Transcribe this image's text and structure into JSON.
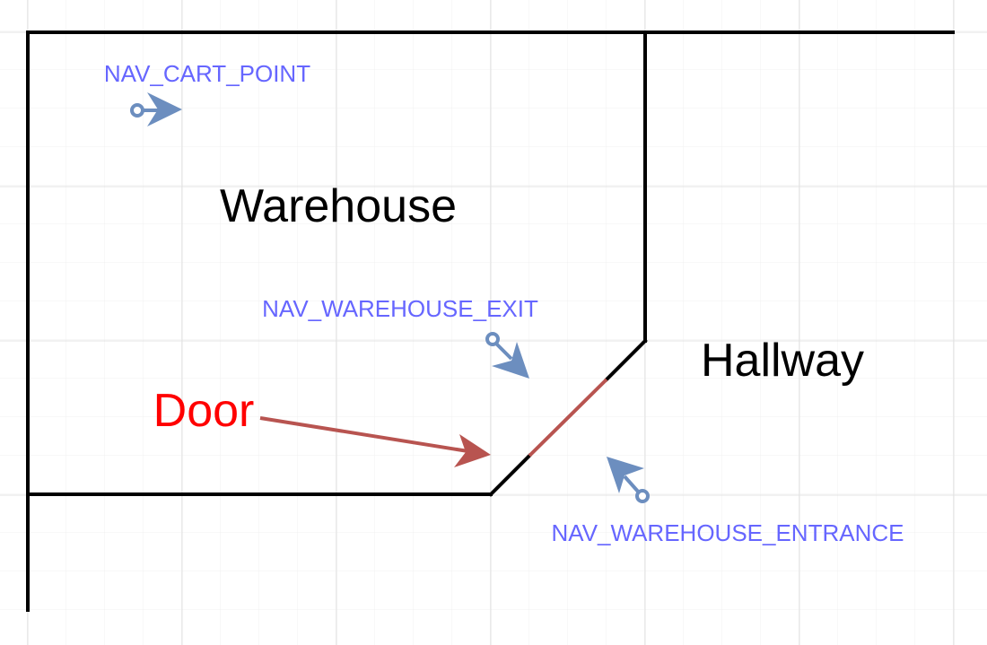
{
  "labels": {
    "warehouse": "Warehouse",
    "hallway": "Hallway",
    "door": "Door"
  },
  "nav_points": {
    "cart_point": "NAV_CART_POINT",
    "warehouse_exit": "NAV_WAREHOUSE_EXIT",
    "warehouse_entrance": "NAV_WAREHOUSE_ENTRANCE"
  },
  "colors": {
    "background": "#ffffff",
    "grid": "#e6e6e6",
    "wall": "#000000",
    "door_line": "#b85450",
    "door_arrow": "#b85450",
    "door_text": "#ff0000",
    "room_text": "#000000",
    "nav_text": "#6666ff",
    "nav_marker": "#6c8ebf"
  }
}
